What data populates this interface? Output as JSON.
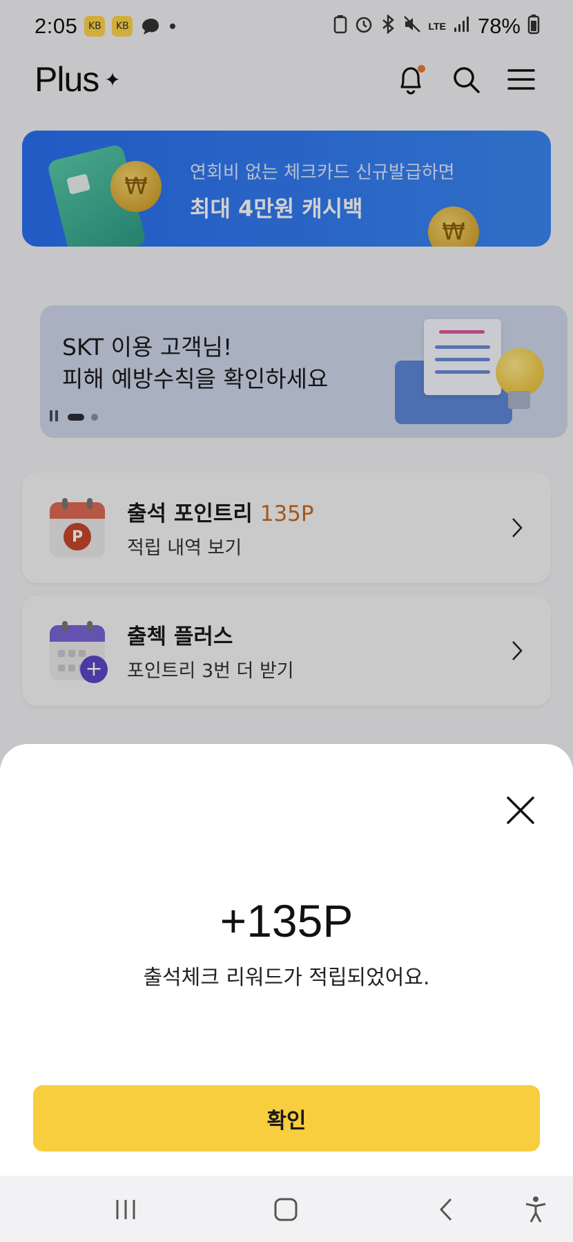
{
  "status_bar": {
    "time": "2:05",
    "badge_text": "KB",
    "battery": "78%",
    "network": "LTE"
  },
  "header": {
    "logo": "Plus",
    "logo_mark": "✦"
  },
  "banner_card": {
    "line1": "연회비 없는 체크카드 신규발급하면",
    "line2": "최대 4만원 캐시백"
  },
  "banner_notice": {
    "line1": "SKT 이용 고객님!",
    "line2": "피해 예방수칙을 확인하세요"
  },
  "list": {
    "attendance": {
      "title": "출석 포인트리",
      "points": "135P",
      "subtitle": "적립 내역 보기",
      "icon_letter": "P"
    },
    "plus": {
      "title": "출첵 플러스",
      "subtitle": "포인트리 3번 더 받기"
    }
  },
  "sheet": {
    "points": "+135P",
    "message": "출석체크 리워드가 적립되었어요.",
    "confirm_label": "확인"
  },
  "colors": {
    "accent_yellow": "#f8cd3e",
    "points_orange": "#c86a22",
    "banner_blue": "#2a6ff0"
  }
}
